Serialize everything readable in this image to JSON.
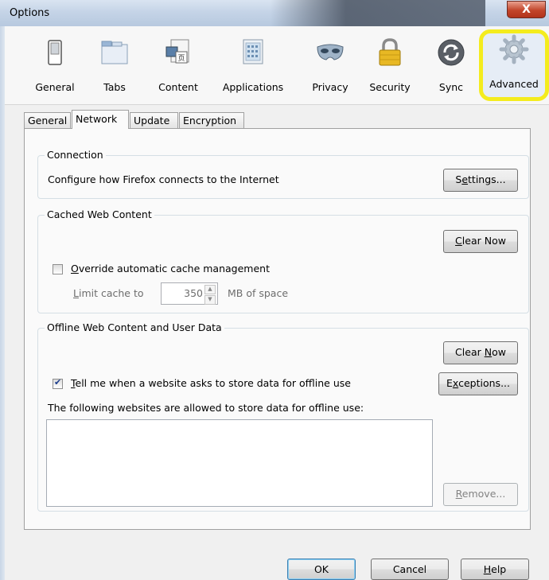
{
  "window": {
    "title": "Options",
    "close_glyph": "X"
  },
  "toolbar": {
    "items": [
      {
        "label": "General",
        "icon": "switch-icon"
      },
      {
        "label": "Tabs",
        "icon": "tabs-window-icon"
      },
      {
        "label": "Content",
        "icon": "content-page-icon"
      },
      {
        "label": "Applications",
        "icon": "applications-list-icon"
      },
      {
        "label": "Privacy",
        "icon": "mask-icon"
      },
      {
        "label": "Security",
        "icon": "padlock-icon"
      },
      {
        "label": "Sync",
        "icon": "sync-arrows-icon"
      },
      {
        "label": "Advanced",
        "icon": "gear-icon",
        "selected": true
      }
    ]
  },
  "subtabs": [
    "General",
    "Network",
    "Update",
    "Encryption"
  ],
  "active_subtab": "Network",
  "connection": {
    "title": "Connection",
    "description": "Configure how Firefox connects to the Internet",
    "settings_button": {
      "pre": "S",
      "u": "e",
      "post": "ttings..."
    }
  },
  "cache": {
    "title": "Cached Web Content",
    "clear_button": {
      "pre": "",
      "u": "C",
      "post": "lear Now"
    },
    "override_label": {
      "pre": "",
      "u": "O",
      "post": "verride automatic cache management"
    },
    "override_checked": false,
    "limit_label": {
      "pre": "",
      "u": "L",
      "post": "imit cache to"
    },
    "limit_value": "350",
    "limit_unit": "MB of space"
  },
  "offline": {
    "title": "Offline Web Content and User Data",
    "clear_button": {
      "pre": "Clear ",
      "u": "N",
      "post": "ow"
    },
    "tell_label": {
      "pre": "",
      "u": "T",
      "post": "ell me when a website asks to store data for offline use"
    },
    "tell_checked": true,
    "exceptions_button": {
      "pre": "E",
      "u": "x",
      "post": "ceptions..."
    },
    "allowed_label": "The following websites are allowed to store data for offline use:",
    "remove_button": {
      "pre": "",
      "u": "R",
      "post": "emove..."
    }
  },
  "footer": {
    "ok": "OK",
    "cancel": "Cancel",
    "help": {
      "pre": "",
      "u": "H",
      "post": "elp"
    }
  },
  "colors": {
    "selected_highlight": "#f4ec1e",
    "close_red": "#c2452b"
  }
}
